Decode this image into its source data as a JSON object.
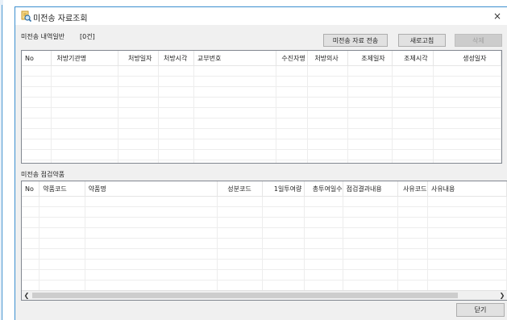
{
  "window": {
    "title": "미전송 자료조회",
    "close_label": "×"
  },
  "top_section": {
    "label": "미전송 내역일반",
    "count": "[0건]",
    "buttons": {
      "send": "미전송 자료 전송",
      "refresh": "새로고침",
      "delete": "삭제"
    },
    "columns": [
      "No",
      "처방기관명",
      "처방일자",
      "처방시각",
      "교부번호",
      "수진자명",
      "처방의사",
      "조제일자",
      "조제시각",
      "생성일자"
    ],
    "rows": [
      [
        "",
        "",
        "",
        "",
        "",
        "",
        "",
        "",
        "",
        ""
      ],
      [
        "",
        "",
        "",
        "",
        "",
        "",
        "",
        "",
        "",
        ""
      ],
      [
        "",
        "",
        "",
        "",
        "",
        "",
        "",
        "",
        "",
        ""
      ],
      [
        "",
        "",
        "",
        "",
        "",
        "",
        "",
        "",
        "",
        ""
      ],
      [
        "",
        "",
        "",
        "",
        "",
        "",
        "",
        "",
        "",
        ""
      ],
      [
        "",
        "",
        "",
        "",
        "",
        "",
        "",
        "",
        "",
        ""
      ],
      [
        "",
        "",
        "",
        "",
        "",
        "",
        "",
        "",
        "",
        ""
      ],
      [
        "",
        "",
        "",
        "",
        "",
        "",
        "",
        "",
        "",
        ""
      ],
      [
        "",
        "",
        "",
        "",
        "",
        "",
        "",
        "",
        "",
        ""
      ],
      [
        "",
        "",
        "",
        "",
        "",
        "",
        "",
        "",
        "",
        ""
      ],
      [
        "",
        "",
        "",
        "",
        "",
        "",
        "",
        "",
        "",
        ""
      ]
    ]
  },
  "bottom_section": {
    "label": "미전송 점검약품",
    "columns": [
      "No",
      "약품코드",
      "약품명",
      "성분코드",
      "1일투여량",
      "총투여일수",
      "점검결과내용",
      "사유코드",
      "사유내용"
    ],
    "rows": [
      [
        "",
        "",
        "",
        "",
        "",
        "",
        "",
        "",
        ""
      ],
      [
        "",
        "",
        "",
        "",
        "",
        "",
        "",
        "",
        ""
      ],
      [
        "",
        "",
        "",
        "",
        "",
        "",
        "",
        "",
        ""
      ],
      [
        "",
        "",
        "",
        "",
        "",
        "",
        "",
        "",
        ""
      ],
      [
        "",
        "",
        "",
        "",
        "",
        "",
        "",
        "",
        ""
      ],
      [
        "",
        "",
        "",
        "",
        "",
        "",
        "",
        "",
        ""
      ],
      [
        "",
        "",
        "",
        "",
        "",
        "",
        "",
        "",
        ""
      ],
      [
        "",
        "",
        "",
        "",
        "",
        "",
        "",
        "",
        ""
      ],
      [
        "",
        "",
        "",
        "",
        "",
        "",
        "",
        "",
        ""
      ],
      [
        "",
        "",
        "",
        "",
        "",
        "",
        "",
        "",
        ""
      ]
    ]
  },
  "footer": {
    "close_button": "닫기"
  },
  "colors": {
    "window_border": "#3c8fcf",
    "dialog_bg": "#f0f0f0",
    "grid_border": "#828790"
  },
  "icons": {
    "title": "search-document-icon",
    "scroll_left": "chevron-left-icon",
    "scroll_right": "chevron-right-icon"
  }
}
